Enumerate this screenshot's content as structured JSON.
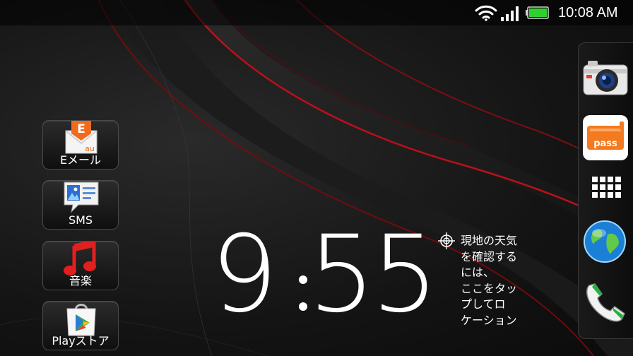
{
  "status_bar": {
    "time": "10:08 AM",
    "wifi_icon": "wifi-icon",
    "signal_icon": "signal-bars-icon",
    "battery_icon": "battery-full-icon",
    "battery_color": "#2fd12f"
  },
  "shortcuts": [
    {
      "label": "Eメール",
      "icon": "email-icon",
      "icon_text": "E",
      "badge": "au",
      "color": "#f26b1d"
    },
    {
      "label": "SMS",
      "icon": "sms-icon"
    },
    {
      "label": "音楽",
      "icon": "music-icon",
      "color": "#e02020"
    },
    {
      "label": "Playストア",
      "icon": "play-store-icon"
    }
  ],
  "clock": {
    "hours": "9",
    "minutes": "55"
  },
  "weather": {
    "lines": [
      "現地の天気",
      "を確認する",
      "には、",
      "ここをタッ",
      "プしてロ",
      "ケーション"
    ],
    "icon": "location-target-icon"
  },
  "dock": {
    "items": [
      {
        "name": "camera",
        "icon": "camera-icon"
      },
      {
        "name": "pass",
        "icon": "pass-icon",
        "label": "pass",
        "color": "#f47a20"
      },
      {
        "name": "apps",
        "icon": "app-grid-icon"
      },
      {
        "name": "browser",
        "icon": "globe-icon"
      },
      {
        "name": "phone",
        "icon": "phone-icon",
        "color": "#1eb53a"
      }
    ]
  },
  "wallpaper": {
    "accent": "#c4101a"
  }
}
